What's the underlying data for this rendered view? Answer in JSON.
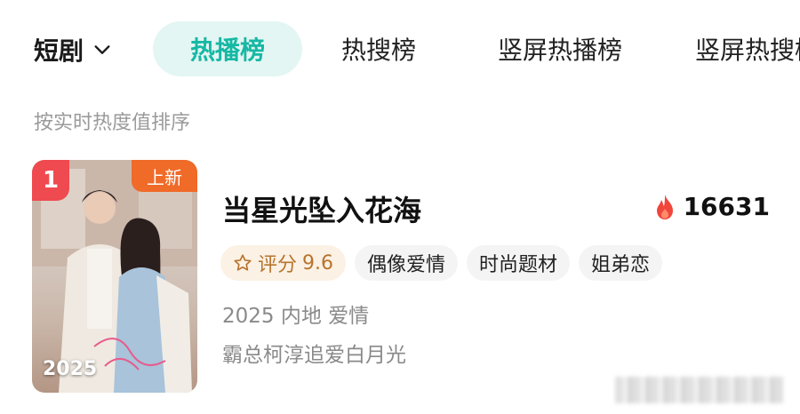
{
  "tabs": {
    "category": "短剧",
    "items": [
      {
        "label": "热播榜",
        "active": true
      },
      {
        "label": "热搜榜",
        "active": false
      },
      {
        "label": "竖屏热播榜",
        "active": false
      },
      {
        "label": "竖屏热搜榜",
        "active": false
      }
    ]
  },
  "sort_note": "按实时热度值排序",
  "card": {
    "rank": "1",
    "new_badge": "上新",
    "poster_year": "2025",
    "title": "当星光坠入花海",
    "heat_value": "16631",
    "rating_label": "评分",
    "rating_value": "9.6",
    "tags": [
      "偶像爱情",
      "时尚题材",
      "姐弟恋"
    ],
    "meta": "2025 内地 爱情",
    "description": "霸总柯淳追爱白月光"
  },
  "colors": {
    "accent": "#16b8a4",
    "active_tab_bg": "#e3f6f3",
    "rank_red": "#ef4a50",
    "new_orange": "#f06a28",
    "flame_red": "#f0463c",
    "rating_text": "#b8742e"
  },
  "icons": {
    "category_toggle": "chevron-down-icon",
    "heat": "flame-icon",
    "rating": "star-outline-icon"
  }
}
